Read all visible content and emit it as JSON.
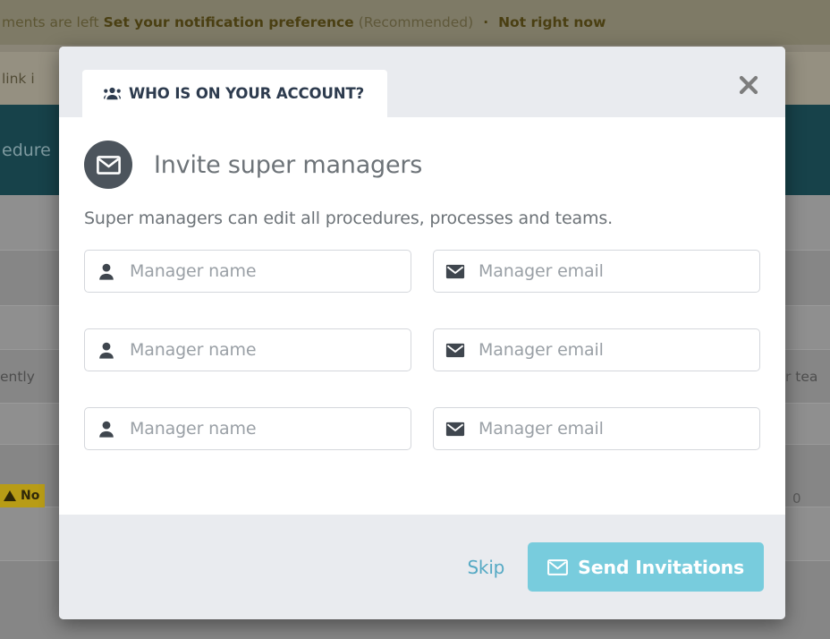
{
  "background": {
    "banner": {
      "lead_text": "ments are left",
      "link_text": "Set your notification preference",
      "note_text": "(Recommended)",
      "separator": "·",
      "dismiss_text": "Not right now"
    },
    "subbar_text": "link i",
    "teal_text": "edure",
    "rows": [
      {
        "text": ""
      },
      {
        "text": "ently"
      },
      {
        "text": ""
      },
      {
        "text": "r tea"
      },
      {
        "text": ""
      }
    ],
    "warning_badge": "No",
    "counter_value": "0",
    "right_text": "r tea",
    "colors": {
      "banner": "#7e7a66",
      "subbar": "#959081",
      "teal": "#17424a",
      "row": "#8b8b8b",
      "warning": "#b89c16"
    }
  },
  "modal": {
    "tab": {
      "label": "WHO IS ON YOUR ACCOUNT?",
      "icon": "users-icon"
    },
    "close_icon": "close-icon",
    "title": {
      "icon": "envelope-icon",
      "text": "Invite super managers"
    },
    "subtitle": "Super managers can edit all procedures, processes and teams.",
    "fields": [
      {
        "name_placeholder": "Manager name",
        "name_value": "",
        "name_icon": "person-icon",
        "email_placeholder": "Manager email",
        "email_value": "",
        "email_icon": "envelope-icon"
      },
      {
        "name_placeholder": "Manager name",
        "name_value": "",
        "name_icon": "person-icon",
        "email_placeholder": "Manager email",
        "email_value": "",
        "email_icon": "envelope-icon"
      },
      {
        "name_placeholder": "Manager name",
        "name_value": "",
        "name_icon": "person-icon",
        "email_placeholder": "Manager email",
        "email_value": "",
        "email_icon": "envelope-icon"
      }
    ],
    "footer": {
      "skip_label": "Skip",
      "send_label": "Send Invitations",
      "send_icon": "envelope-icon"
    },
    "colors": {
      "accent": "#78ccdd",
      "link": "#55a9c4",
      "header_bg": "#e9ebef",
      "badge_bg": "#4c545c",
      "tab_text": "#2d3b4e"
    }
  }
}
